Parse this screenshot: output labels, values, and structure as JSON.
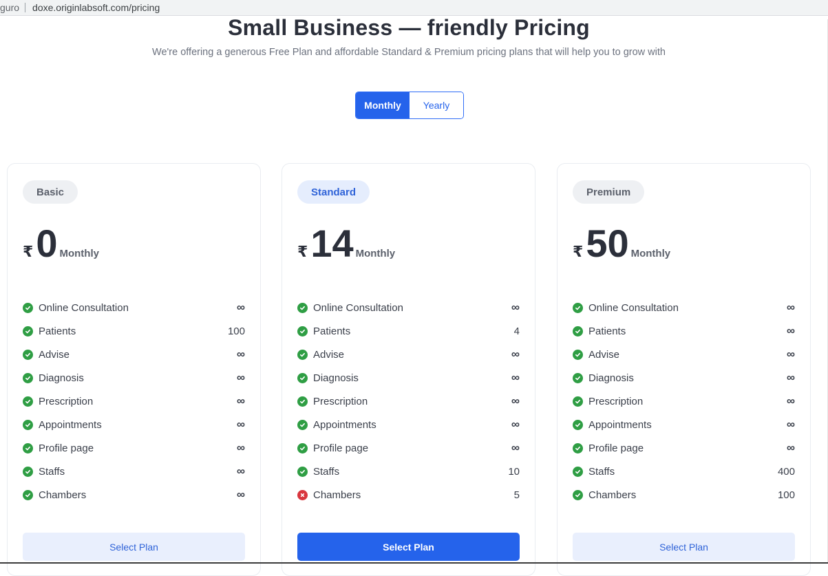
{
  "browser": {
    "site": "guro",
    "url": "doxe.originlabsoft.com/pricing"
  },
  "header": {
    "title": "Small Business — friendly Pricing",
    "subtitle": "We're offering a generous Free Plan and affordable Standard & Premium pricing plans that will help you to grow with"
  },
  "billing_toggle": {
    "monthly": "Monthly",
    "yearly": "Yearly",
    "selected": "Monthly"
  },
  "colors": {
    "accent": "#2563eb",
    "check": "#2f9e44",
    "cross": "#d9363e"
  },
  "plans": [
    {
      "name": "Basic",
      "currency": "₹",
      "price": "0",
      "period": "Monthly",
      "button": "Select Plan",
      "features": [
        {
          "label": "Online Consultation",
          "value": "∞",
          "included": true
        },
        {
          "label": "Patients",
          "value": "100",
          "included": true
        },
        {
          "label": "Advise",
          "value": "∞",
          "included": true
        },
        {
          "label": "Diagnosis",
          "value": "∞",
          "included": true
        },
        {
          "label": "Prescription",
          "value": "∞",
          "included": true
        },
        {
          "label": "Appointments",
          "value": "∞",
          "included": true
        },
        {
          "label": "Profile page",
          "value": "∞",
          "included": true
        },
        {
          "label": "Staffs",
          "value": "∞",
          "included": true
        },
        {
          "label": "Chambers",
          "value": "∞",
          "included": true
        }
      ]
    },
    {
      "name": "Standard",
      "currency": "₹",
      "price": "14",
      "period": "Monthly",
      "button": "Select Plan",
      "features": [
        {
          "label": "Online Consultation",
          "value": "∞",
          "included": true
        },
        {
          "label": "Patients",
          "value": "4",
          "included": true
        },
        {
          "label": "Advise",
          "value": "∞",
          "included": true
        },
        {
          "label": "Diagnosis",
          "value": "∞",
          "included": true
        },
        {
          "label": "Prescription",
          "value": "∞",
          "included": true
        },
        {
          "label": "Appointments",
          "value": "∞",
          "included": true
        },
        {
          "label": "Profile page",
          "value": "∞",
          "included": true
        },
        {
          "label": "Staffs",
          "value": "10",
          "included": true
        },
        {
          "label": "Chambers",
          "value": "5",
          "included": false
        }
      ]
    },
    {
      "name": "Premium",
      "currency": "₹",
      "price": "50",
      "period": "Monthly",
      "button": "Select Plan",
      "features": [
        {
          "label": "Online Consultation",
          "value": "∞",
          "included": true
        },
        {
          "label": "Patients",
          "value": "∞",
          "included": true
        },
        {
          "label": "Advise",
          "value": "∞",
          "included": true
        },
        {
          "label": "Diagnosis",
          "value": "∞",
          "included": true
        },
        {
          "label": "Prescription",
          "value": "∞",
          "included": true
        },
        {
          "label": "Appointments",
          "value": "∞",
          "included": true
        },
        {
          "label": "Profile page",
          "value": "∞",
          "included": true
        },
        {
          "label": "Staffs",
          "value": "400",
          "included": true
        },
        {
          "label": "Chambers",
          "value": "100",
          "included": true
        }
      ]
    }
  ]
}
